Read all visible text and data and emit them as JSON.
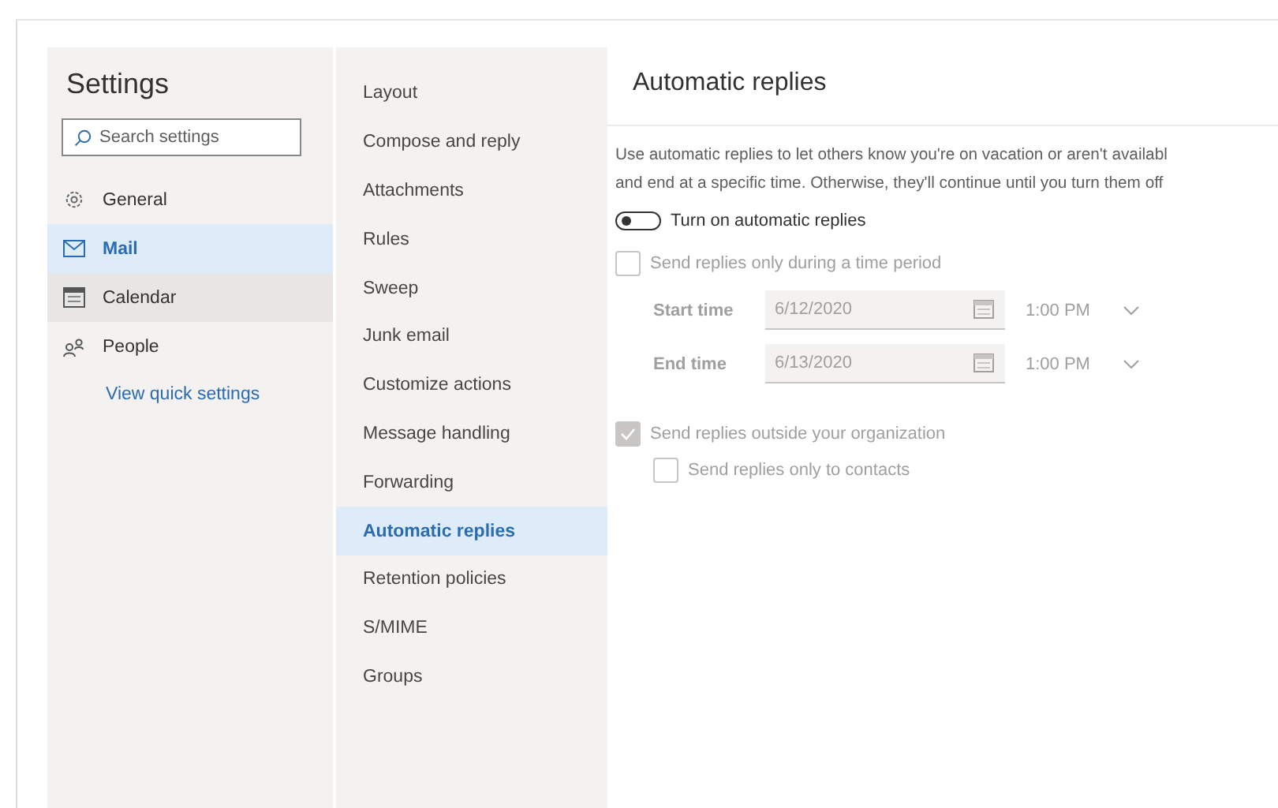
{
  "settings_title": "Settings",
  "search": {
    "placeholder": "Search settings"
  },
  "sidebar": {
    "items": [
      {
        "label": "General",
        "kind": "gear",
        "selected": false,
        "hovered": false
      },
      {
        "label": "Mail",
        "kind": "mail",
        "selected": true,
        "hovered": false
      },
      {
        "label": "Calendar",
        "kind": "calendar",
        "selected": false,
        "hovered": true
      },
      {
        "label": "People",
        "kind": "people",
        "selected": false,
        "hovered": false
      }
    ],
    "link": "View quick settings"
  },
  "categories": [
    {
      "label": "Layout",
      "selected": false
    },
    {
      "label": "Compose and reply",
      "selected": false
    },
    {
      "label": "Attachments",
      "selected": false
    },
    {
      "label": "Rules",
      "selected": false
    },
    {
      "label": "Sweep",
      "selected": false
    },
    {
      "label": "Junk email",
      "selected": false
    },
    {
      "label": "Customize actions",
      "selected": false
    },
    {
      "label": "Message handling",
      "selected": false
    },
    {
      "label": "Forwarding",
      "selected": false
    },
    {
      "label": "Automatic replies",
      "selected": true
    },
    {
      "label": "Retention policies",
      "selected": false
    },
    {
      "label": "S/MIME",
      "selected": false
    },
    {
      "label": "Groups",
      "selected": false
    }
  ],
  "panel": {
    "title": "Automatic replies",
    "description": [
      "Use automatic replies to let others know you're on vacation or aren't availabl",
      "and end at a specific time. Otherwise, they'll continue until you turn them off"
    ],
    "toggle": {
      "label": "Turn on automatic replies",
      "on": false
    },
    "time_period": {
      "label": "Send replies only during a time period",
      "checked": false,
      "disabled": true
    },
    "times": [
      {
        "label": "Start time",
        "date": "6/12/2020",
        "time": "1:00 PM"
      },
      {
        "label": "End time",
        "date": "6/13/2020",
        "time": "1:00 PM"
      }
    ],
    "outside": {
      "label": "Send replies outside your organization",
      "checked": true,
      "disabled": true
    },
    "contacts": {
      "label": "Send replies only to contacts",
      "checked": false,
      "disabled": true
    }
  }
}
